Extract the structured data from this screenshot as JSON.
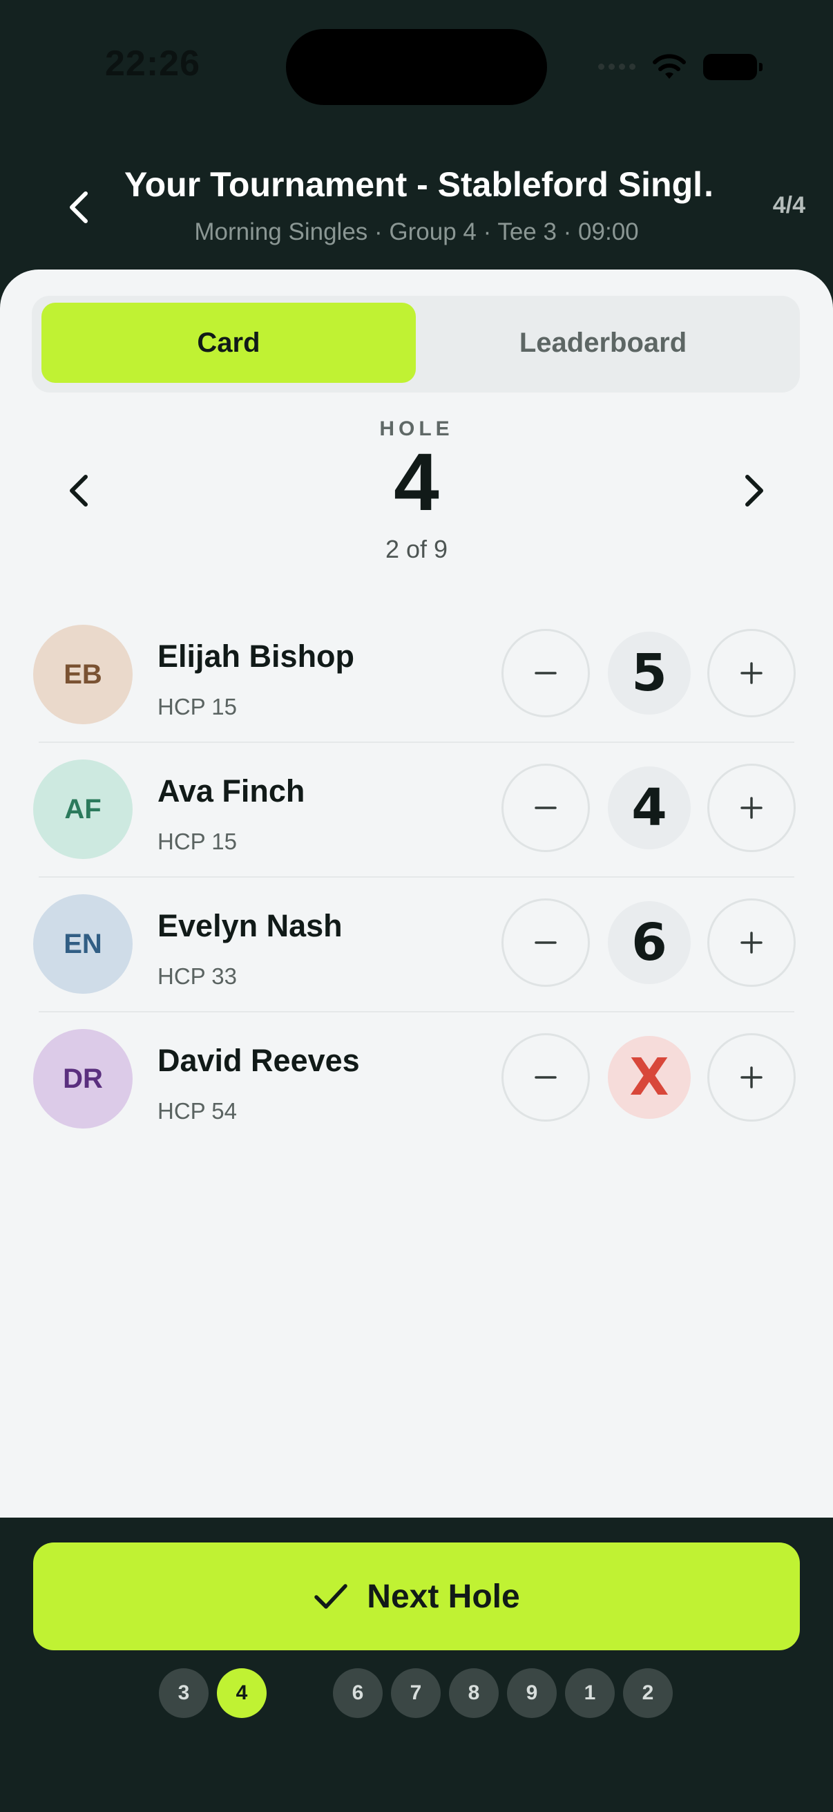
{
  "status_bar": {
    "time": "22:26"
  },
  "header": {
    "title": "Your Tournament - Stableford Singl…",
    "subtitle": "Morning Singles · Group 4 · Tee 3 · 09:00",
    "count": "4/4"
  },
  "tabs": [
    {
      "label": "Card",
      "active": true
    },
    {
      "label": "Leaderboard",
      "active": false
    }
  ],
  "hole": {
    "label": "HOLE",
    "number": "4",
    "progress": "2 of 9"
  },
  "players": [
    {
      "initials": "EB",
      "name": "Elijah Bishop",
      "hcp": "HCP 15",
      "score": "5",
      "avatar_bg": "#ead9cb",
      "avatar_fg": "#7a5232"
    },
    {
      "initials": "AF",
      "name": "Ava Finch",
      "hcp": "HCP 15",
      "score": "4",
      "avatar_bg": "#cde9e0",
      "avatar_fg": "#2b7a5c"
    },
    {
      "initials": "EN",
      "name": "Evelyn Nash",
      "hcp": "HCP 33",
      "score": "6",
      "avatar_bg": "#cfdce8",
      "avatar_fg": "#315e84"
    },
    {
      "initials": "DR",
      "name": "David Reeves",
      "hcp": "HCP 54",
      "score": "X",
      "avatar_bg": "#dccbe8",
      "avatar_fg": "#5a2f7e"
    }
  ],
  "footer": {
    "next_label": "Next Hole",
    "holes": [
      "3",
      "4",
      "6",
      "7",
      "8",
      "9",
      "1",
      "2"
    ],
    "active_hole": "4"
  },
  "colors": {
    "accent": "#c0f233",
    "dark": "#142220",
    "error": "#d8473a"
  }
}
